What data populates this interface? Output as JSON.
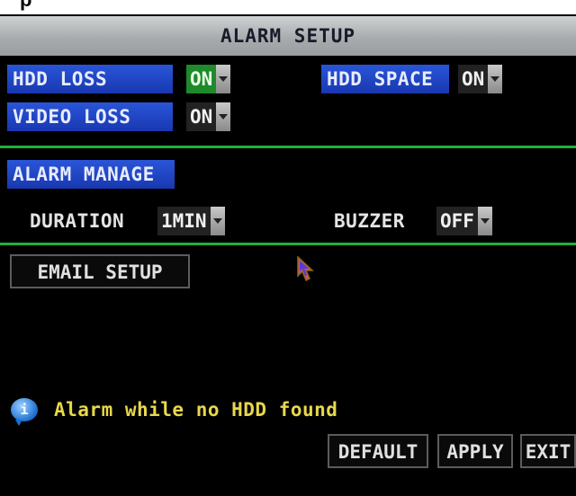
{
  "header": {
    "title": "ALARM SETUP",
    "cut_text": "p"
  },
  "alarm": {
    "hdd_loss": {
      "label": "HDD LOSS",
      "value": "ON"
    },
    "hdd_space": {
      "label": "HDD SPACE",
      "value": "ON"
    },
    "video_loss": {
      "label": "VIDEO LOSS",
      "value": "ON"
    }
  },
  "manage": {
    "label": "ALARM MANAGE",
    "duration": {
      "label": "DURATION",
      "value": "1MIN"
    },
    "buzzer": {
      "label": "BUZZER",
      "value": "OFF"
    }
  },
  "email_button": "EMAIL SETUP",
  "tip": {
    "icon": "info-bubble-icon",
    "text": "Alarm while no HDD found"
  },
  "buttons": {
    "default": "DEFAULT",
    "apply": "APPLY",
    "exit": "EXIT"
  },
  "colors": {
    "divider": "#1fb23a",
    "label_bg": "#2a55d8",
    "tip_text": "#e8d84a",
    "selected_value_bg": "#1e8a2a"
  }
}
